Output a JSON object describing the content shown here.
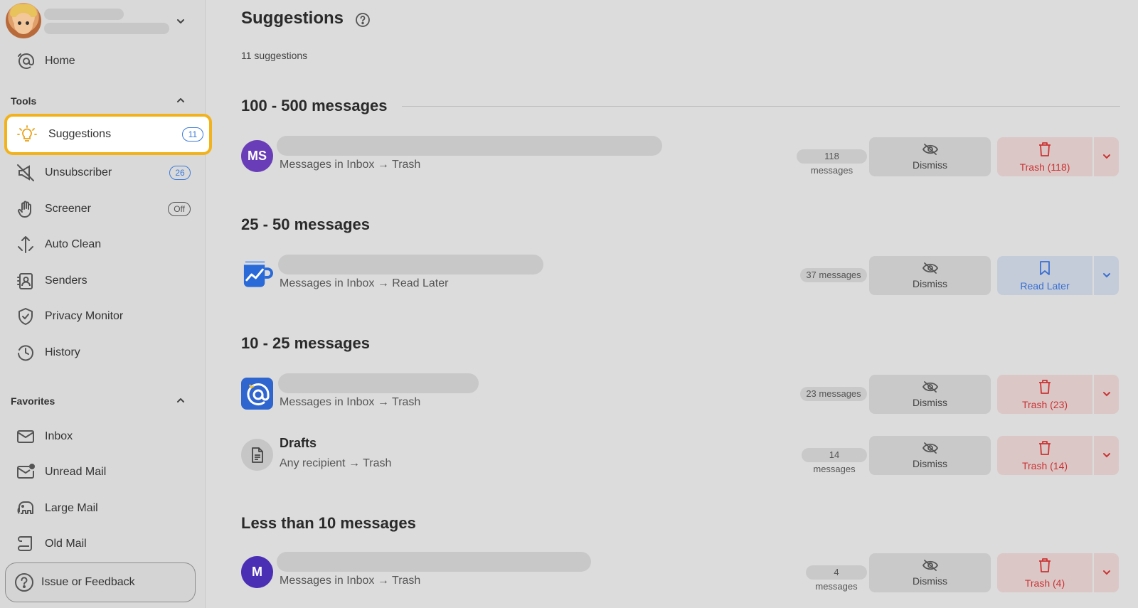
{
  "sidebar": {
    "nav": {
      "home": "Home",
      "tools_heading": "Tools",
      "suggestions": "Suggestions",
      "suggestions_badge": "11",
      "unsubscriber": "Unsubscriber",
      "unsubscriber_badge": "26",
      "screener": "Screener",
      "screener_badge": "Off",
      "auto_clean": "Auto Clean",
      "senders": "Senders",
      "privacy_monitor": "Privacy Monitor",
      "history": "History",
      "favorites_heading": "Favorites",
      "inbox": "Inbox",
      "unread_mail": "Unread Mail",
      "large_mail": "Large Mail",
      "old_mail": "Old Mail"
    },
    "feedback": "Issue or Feedback"
  },
  "main": {
    "title": "Suggestions",
    "count": "11 suggestions",
    "groups": [
      {
        "heading": "100 - 500 messages",
        "rows": [
          {
            "avatar": "MS",
            "avatar_color": "#6a3db8",
            "rule": "Messages in Inbox → Trash",
            "messages": "118 messages",
            "dismiss": "Dismiss",
            "action": "Trash (118)"
          }
        ]
      },
      {
        "heading": "25 - 50 messages",
        "rows": [
          {
            "avatar_icon": "chart-mug-icon",
            "rule": "Messages in Inbox → Read Later",
            "messages": "37 messages",
            "dismiss": "Dismiss",
            "action": "Read Later"
          }
        ]
      },
      {
        "heading": "10 - 25 messages",
        "rows": [
          {
            "avatar_icon": "at-sign-app-icon",
            "rule": "Messages in Inbox → Trash",
            "messages": "23 messages",
            "dismiss": "Dismiss",
            "action": "Trash (23)"
          },
          {
            "avatar_icon": "document-icon",
            "name": "Drafts",
            "rule": "Any recipient → Trash",
            "messages": "14 messages",
            "dismiss": "Dismiss",
            "action": "Trash (14)"
          }
        ]
      },
      {
        "heading": "Less than 10 messages",
        "rows": [
          {
            "avatar": "M",
            "avatar_color": "#4a2fb5",
            "rule": "Messages in Inbox → Trash",
            "messages": "4 messages",
            "dismiss": "Dismiss",
            "action": "Trash (4)"
          }
        ]
      }
    ]
  },
  "colors": {
    "accent_highlight": "#f2b21b",
    "badge_blue": "#3d7bd9",
    "trash_red": "#c93434",
    "read_later_blue": "#3b6fd0"
  }
}
